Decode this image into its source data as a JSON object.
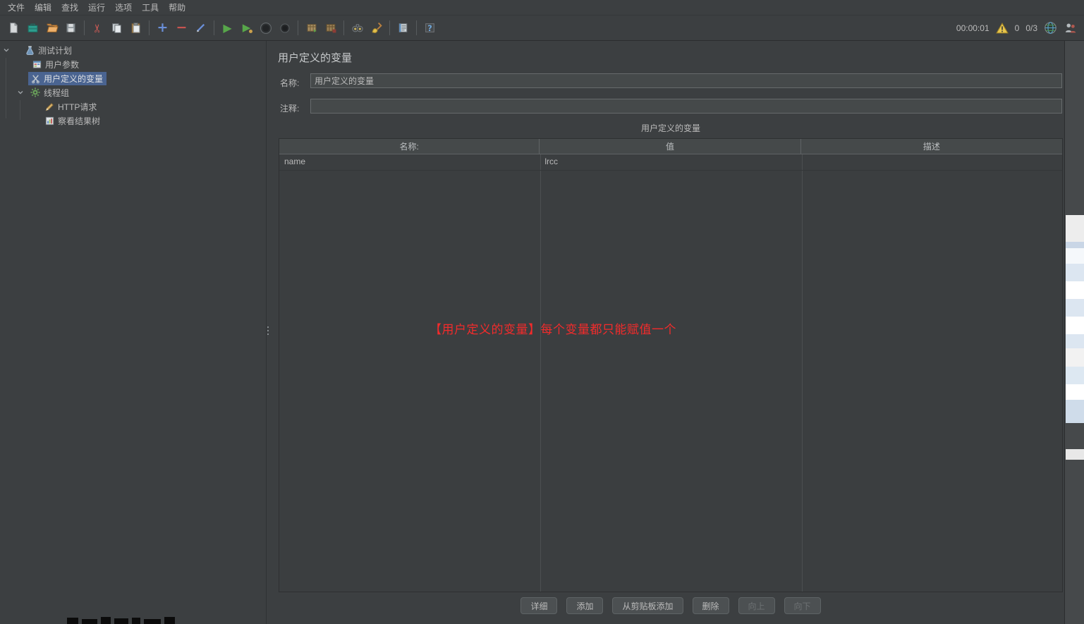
{
  "menu": {
    "items": [
      "文件",
      "编辑",
      "查找",
      "运行",
      "选项",
      "工具",
      "帮助"
    ]
  },
  "toolbar": {
    "timer": "00:00:01",
    "error_count": "0",
    "thread_count": "0/3"
  },
  "tree": {
    "items": [
      {
        "label": "测试计划"
      },
      {
        "label": "用户参数"
      },
      {
        "label": "用户定义的变量"
      },
      {
        "label": "线程组"
      },
      {
        "label": "HTTP请求"
      },
      {
        "label": "察看结果树"
      }
    ]
  },
  "main": {
    "title": "用户定义的变量",
    "name_label": "名称:",
    "name_value": "用户定义的变量",
    "comment_label": "注释:",
    "comment_value": "",
    "table": {
      "title": "用户定义的变量",
      "columns": [
        "名称:",
        "值",
        "描述"
      ],
      "rows": [
        [
          "name",
          "lrcc",
          ""
        ]
      ]
    },
    "annotation": "【用户定义的变量】每个变量都只能赋值一个",
    "buttons": [
      {
        "label": "详细",
        "enabled": true
      },
      {
        "label": "添加",
        "enabled": true
      },
      {
        "label": "从剪贴板添加",
        "enabled": true
      },
      {
        "label": "删除",
        "enabled": true
      },
      {
        "label": "向上",
        "enabled": false
      },
      {
        "label": "向下",
        "enabled": false
      }
    ]
  },
  "colors": {
    "background": "#3c3f41",
    "selection": "#4a6491",
    "annotation_red": "#f32b2b",
    "accent_green": "#57a64a"
  }
}
